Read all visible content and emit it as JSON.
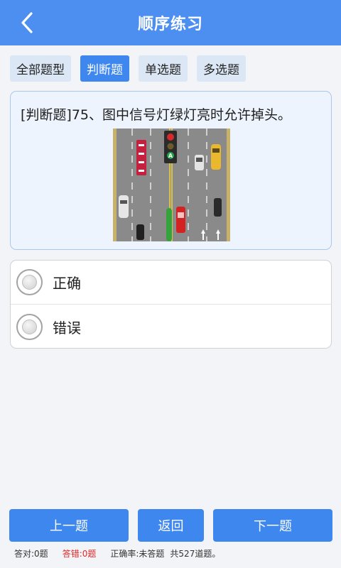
{
  "header": {
    "title": "顺序练习",
    "back_icon": "chevron-left-icon"
  },
  "filters": [
    {
      "label": "全部题型",
      "active": false
    },
    {
      "label": "判断题",
      "active": true
    },
    {
      "label": "单选题",
      "active": false
    },
    {
      "label": "多选题",
      "active": false
    }
  ],
  "question": {
    "text": "[判断题]75、图中信号灯绿灯亮时允许掉头。",
    "signal_arrow": "A"
  },
  "options": [
    {
      "label": "正确"
    },
    {
      "label": "错误"
    }
  ],
  "buttons": {
    "prev": "上一题",
    "back": "返回",
    "next": "下一题"
  },
  "stats": {
    "correct": "答对:0题",
    "wrong": "答错:0题",
    "rate": "正确率:未答题",
    "total": "共527道题。"
  },
  "colors": {
    "header": "#4d8ff0",
    "accent": "#3e87ef",
    "wrong": "#e32626"
  }
}
